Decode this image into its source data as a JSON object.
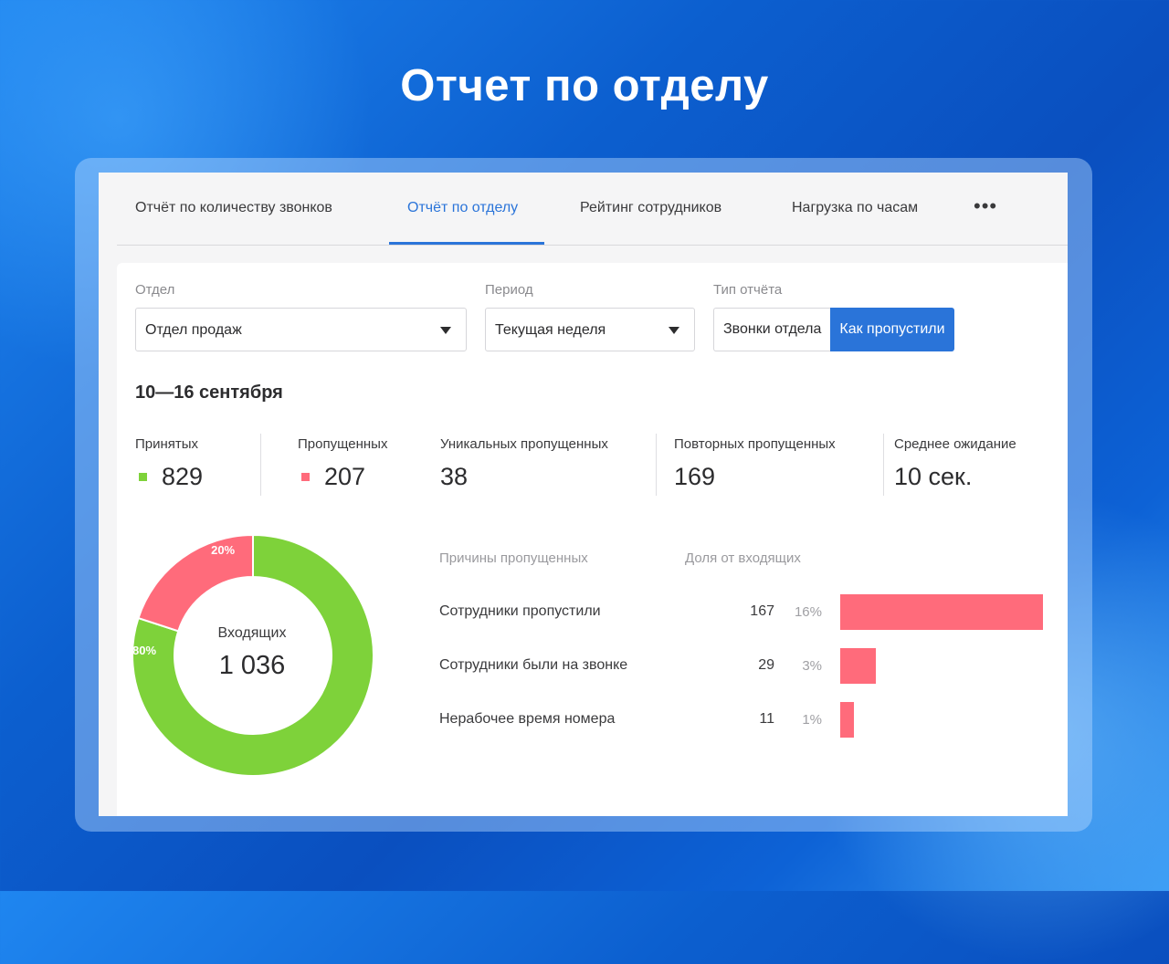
{
  "page": {
    "title": "Отчет по отделу"
  },
  "tabs": [
    {
      "label": "Отчёт по количеству звонков",
      "active": false
    },
    {
      "label": "Отчёт по отделу",
      "active": true
    },
    {
      "label": "Рейтинг сотрудников",
      "active": false
    },
    {
      "label": "Нагрузка по часам",
      "active": false
    }
  ],
  "more": {
    "label": "•••",
    "icon": "more-horizontal-icon"
  },
  "filters": {
    "department": {
      "label": "Отдел",
      "value": "Отдел продаж"
    },
    "period": {
      "label": "Период",
      "value": "Текущая неделя"
    },
    "report_type": {
      "label": "Тип отчёта",
      "options": [
        "Звонки отдела",
        "Как пропустили"
      ],
      "selected": "Как пропустили"
    }
  },
  "date_range": "10—16 сентября",
  "stats": [
    {
      "label": "Принятых",
      "value": "829",
      "color": "#7ed23a"
    },
    {
      "label": "Пропущенных",
      "value": "207",
      "color": "#ff6b7b"
    },
    {
      "label": "Уникальных пропущенных",
      "value": "38"
    },
    {
      "label": "Повторных пропущенных",
      "value": "169"
    },
    {
      "label": "Среднее ожидание",
      "value": "10 сек."
    }
  ],
  "colors": {
    "accent": "#2a74d9",
    "accepted": "#7ed23a",
    "missed": "#ff6b7b"
  },
  "chart_data": [
    {
      "type": "pie",
      "variant": "donut",
      "title": "",
      "center_label": "Входящих",
      "center_value": "1 036",
      "slices": [
        {
          "label": "80%",
          "value": 829,
          "color": "#7ed23a"
        },
        {
          "label": "20%",
          "value": 207,
          "color": "#ff6b7b"
        }
      ]
    },
    {
      "type": "bar",
      "orientation": "horizontal",
      "headers": {
        "reason": "Причины пропущенных",
        "share": "Доля от входящих"
      },
      "categories": [
        "Сотрудники пропустили",
        "Сотрудники были на звонке",
        "Нерабочее время номера"
      ],
      "values": [
        167,
        29,
        11
      ],
      "percent_labels": [
        "16%",
        "3%",
        "1%"
      ],
      "color": "#ff6b7b"
    }
  ]
}
